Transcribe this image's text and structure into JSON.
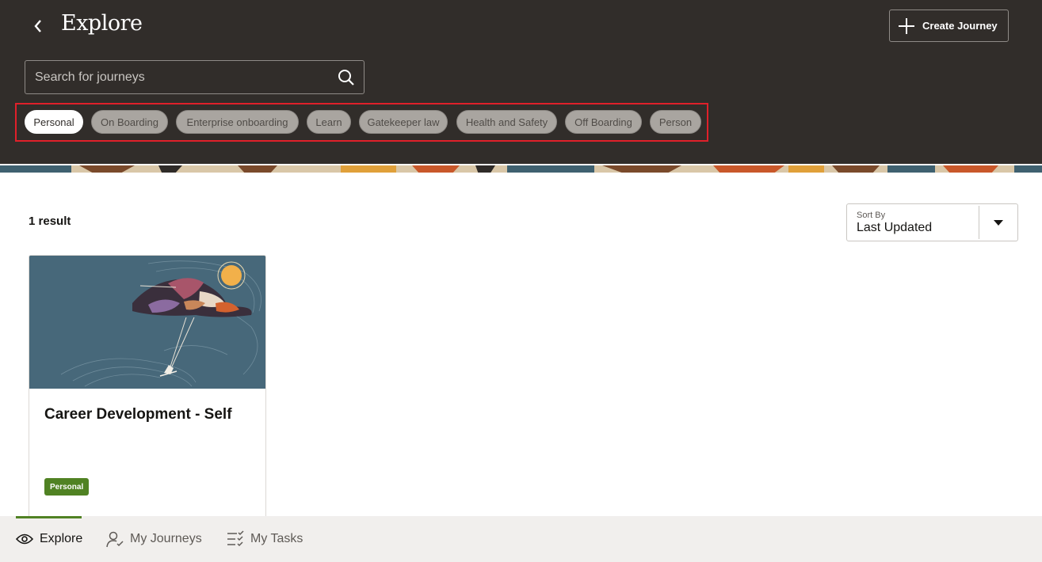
{
  "header": {
    "title": "Explore",
    "create_label": "Create Journey",
    "search_placeholder": "Search for journeys"
  },
  "chips": [
    {
      "label": "Personal",
      "selected": true
    },
    {
      "label": "On Boarding",
      "selected": false
    },
    {
      "label": "Enterprise onboarding",
      "selected": false
    },
    {
      "label": "Learn",
      "selected": false
    },
    {
      "label": "Gatekeeper law",
      "selected": false
    },
    {
      "label": "Health and Safety",
      "selected": false
    },
    {
      "label": "Off Boarding",
      "selected": false
    },
    {
      "label": "Person",
      "selected": false
    }
  ],
  "results": {
    "count_text": "1 result"
  },
  "sort": {
    "label": "Sort By",
    "value": "Last Updated"
  },
  "cards": [
    {
      "title": "Career Development - Self",
      "badge": "Personal"
    }
  ],
  "bottom_nav": [
    {
      "label": "Explore",
      "icon": "eye-icon",
      "active": true
    },
    {
      "label": "My Journeys",
      "icon": "person-check-icon",
      "active": false
    },
    {
      "label": "My Tasks",
      "icon": "task-list-icon",
      "active": false
    }
  ],
  "colors": {
    "header_bg": "#312d2a",
    "highlight_border": "#e0202a",
    "badge_green": "#508223",
    "nav_bg": "#f1efed"
  }
}
